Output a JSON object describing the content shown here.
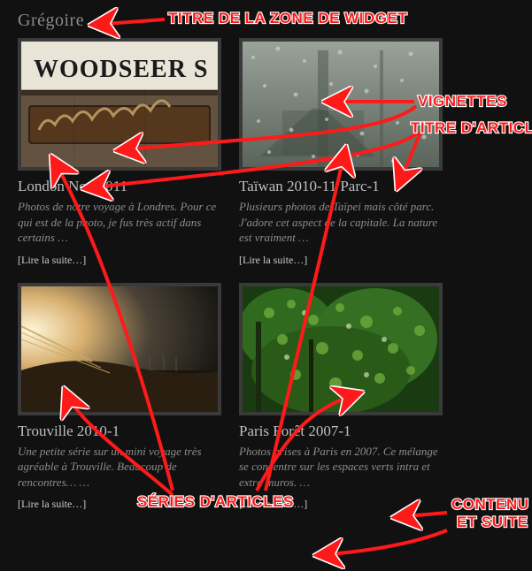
{
  "widget_title": "Grégoire",
  "articles": [
    {
      "title": "London Nov 2011",
      "excerpt": "Photos de notre voyage à Londres. Pour ce qui est de la photo, je fus très actif dans certains …",
      "read_more": "[Lire la suite…]",
      "thumb_icon": "london"
    },
    {
      "title": "Taïwan 2010-11 Parc-1",
      "excerpt": "Plusieurs photos de Taïpei mais côté parc. J'adore cet aspect de la capitale. La nature est vraiment …",
      "read_more": "[Lire la suite…]",
      "thumb_icon": "taiwan"
    },
    {
      "title": "Trouville 2010-1",
      "excerpt": "Une petite série sur un mini voyage très agréable à Trouville. Beaucoup de rencontres… …",
      "read_more": "[Lire la suite…]",
      "thumb_icon": "trouville"
    },
    {
      "title": "Paris Forêt 2007-1",
      "excerpt": "Photos prises à Paris en 2007. Ce mélange se concentre sur les espaces verts intra et extra muros. …",
      "read_more": "[Lire la suite…]",
      "thumb_icon": "paris"
    }
  ],
  "annotations": {
    "widget_zone": "TITRE DE LA ZONE DE WIDGET",
    "vignettes": "VIGNETTES",
    "article_title": "TITRE D'ARTICLE",
    "series": "SÉRIES D'ARTICLES",
    "content": "CONTENU\nET SUITE"
  },
  "colors": {
    "annotation": "#ff1a1a",
    "annotation_stroke": "#ffffff",
    "bg": "#111111",
    "text_muted": "#8c8c8c",
    "text_title": "#bfbfbf",
    "border": "#3a3a3a"
  }
}
